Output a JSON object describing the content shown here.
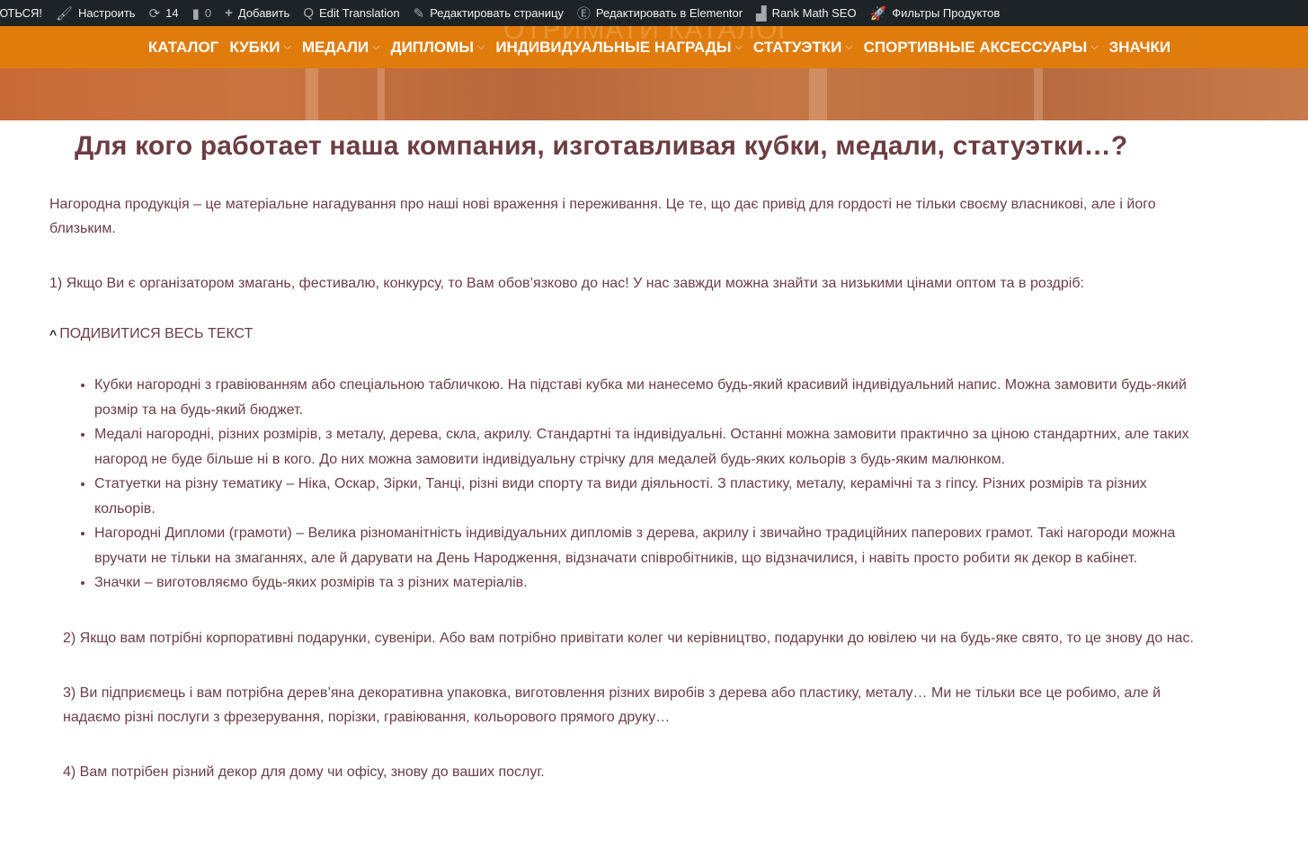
{
  "admin_bar": {
    "items": [
      {
        "icon": "",
        "label": "ЮТЬСЯ!"
      },
      {
        "icon": "brush-icon",
        "label": "Настроить"
      },
      {
        "icon": "updates-icon",
        "label": "14"
      },
      {
        "icon": "comment-icon",
        "label": "0"
      },
      {
        "icon": "plus-icon",
        "label": "Добавить"
      },
      {
        "icon": "translate-icon",
        "label": "Edit Translation"
      },
      {
        "icon": "pencil-icon",
        "label": "Редактировать страницу"
      },
      {
        "icon": "elementor-icon",
        "label": "Редактировать в Elementor"
      },
      {
        "icon": "rank-math-icon",
        "label": "Rank Math SEO"
      },
      {
        "icon": "rocket-icon",
        "label": "Фильтры Продуктов"
      }
    ]
  },
  "hero": {
    "ghost_text": "ОТРИМАТИ КАТАЛОГ"
  },
  "nav": {
    "items": [
      {
        "label": "КАТАЛОГ",
        "dropdown": false
      },
      {
        "label": "КУБКИ",
        "dropdown": true
      },
      {
        "label": "МЕДАЛИ",
        "dropdown": true
      },
      {
        "label": "ДИПЛОМЫ",
        "dropdown": true
      },
      {
        "label": "ИНДИВИДУАЛЬНЫЕ НАГРАДЫ",
        "dropdown": true
      },
      {
        "label": "СТАТУЭТКИ",
        "dropdown": true
      },
      {
        "label": "СПОРТИВНЫЕ АКСЕССУАРЫ",
        "dropdown": true
      },
      {
        "label": "ЗНАЧКИ",
        "dropdown": false
      }
    ]
  },
  "colors": {
    "nav_bg": "#e07c0c",
    "admin_bg": "#1d2327",
    "heading": "#6b3d42",
    "text": "#6a3f45"
  },
  "content": {
    "title": "Для кого работает наша компания, изготавливая кубки, медали, статуэтки…?",
    "intro": "Нагородна продукція – це матеріальне нагадування про наші нові враження і переживання. Це те, що дає привід для гордості не тільки своєму власникові, але і його близьким.",
    "point1": "1) Якщо Ви є організатором змагань, фестивалю, конкурсу, то Вам обов’язково до нас! У нас завжди можна знайти за низькими цінами оптом та в роздріб:",
    "toggle_label": "ПОДИВИТИСЯ ВЕСЬ ТЕКСТ",
    "bullets": [
      "Кубки нагородні з гравіюванням або спеціальною табличкою. На підставі кубка ми нанесемо будь-який красивий індивідуальний напис. Можна замовити будь-який розмір та на будь-який бюджет.",
      "Медалі нагородні, різних розмірів, з металу, дерева, скла, акрилу. Стандартні та індивідуальні. Останні можна замовити практично за ціною стандартних, але таких нагород не буде більше ні в кого. До них можна замовити індивідуальну стрічку для медалей будь-яких кольорів з будь-яким малюнком.",
      "Статуетки на різну тематику – Ніка, Оскар, Зірки, Танці, різні види спорту та види діяльності. З пластику, металу, керамічні та з гіпсу. Різних розмірів та різних кольорів.",
      "Нагородні Дипломи (грамоти) – Велика різноманітність індивідуальних дипломів з дерева, акрилу і звичайно традиційних паперових грамот. Такі нагороди можна вручати не тільки на змаганнях, але й дарувати на День Народження, відзначати співробітників, що відзначилися, і навіть просто робити як декор в кабінет.",
      "Значки – виготовляємо будь-яких розмірів та з різних матеріалів."
    ],
    "point2": " 2) Якщо вам потрібні корпоративні подарунки, сувеніри. Або вам потрібно привітати колег чи керівництво, подарунки до ювілею чи на будь-яке свято, то це знову до нас.",
    "point3": "3) Ви підприємець і вам потрібна дерев’яна декоративна упаковка, виготовлення різних виробів з дерева або пластику, металу… Ми не тільки все це робимо, але й надаємо різні послуги з фрезерування, порізки, гравіювання, кольорового прямого друку…",
    "point4": "4) Вам потрібен різний декор для дому чи офісу, знову до ваших послуг."
  }
}
